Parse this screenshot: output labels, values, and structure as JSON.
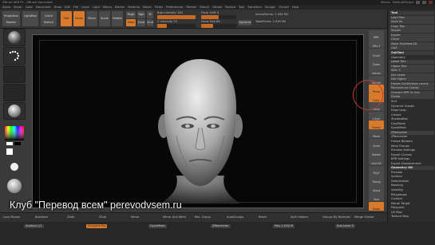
{
  "window": {
    "title": "ZBrush 4R8 P2 - ZBrush Document",
    "controls": [
      "Menus",
      "DefaultZScript"
    ]
  },
  "menu": {
    "items": [
      "Alpha",
      "Brush",
      "Color",
      "Document",
      "Draw",
      "Edit",
      "File",
      "Layer",
      "Light",
      "Macro",
      "Marker",
      "Material",
      "Movie",
      "Picker",
      "Preferences",
      "Render",
      "Stencil",
      "Stroke",
      "Texture",
      "Tool",
      "Transform",
      "Zplugin",
      "Zscript",
      "Help"
    ]
  },
  "toolbar": {
    "projection_master": "Projection Master",
    "lightbox": "LightBox",
    "quick_sketch": "Quick Sketch",
    "edit": "Edit",
    "draw": "Draw",
    "move": "Move",
    "scale": "Scale",
    "rotate": "Rotate",
    "mrgb": "Mrgb",
    "rgb": "Rgb",
    "m": "M",
    "zadd": "Zadd",
    "zsub": "Zsub",
    "zcut": "Zcut",
    "focal_shift_label": "Focal Shift 0",
    "draw_size_label": "Draw Size 64",
    "rgb_intensity_label": "Rgb Intensity 100",
    "z_intensity_label": "Z Intensity 25",
    "dynamic": "Dynamic",
    "active_points": "ActivePoints: 2.034 Mil",
    "total_points": "TotalPoints: 2.034 Mil",
    "z_intensity_level": 0.25,
    "focal_level": 0.5,
    "draw_size_level": 0.35
  },
  "right_shelf": {
    "buttons": [
      "BPR",
      "SPix 3",
      "Scroll",
      "Zoom",
      "Actual",
      "AAHalf",
      "Persp",
      "Floor",
      "Local",
      "L.Sym",
      "Frame",
      "Move",
      "Scale",
      "Rotate",
      "Line Fill",
      "PolyF",
      "Transp",
      "Ghost",
      "Solo",
      "Xpose"
    ]
  },
  "tray": {
    "items": [
      {
        "label": "Tool",
        "type": "header"
      },
      {
        "label": "Load Tool",
        "type": "box"
      },
      {
        "label": "Save As",
        "type": "box"
      },
      {
        "label": "Copy Tool",
        "type": "box"
      },
      {
        "label": "Import",
        "type": "box"
      },
      {
        "label": "Export",
        "type": "box"
      },
      {
        "label": "Clone",
        "type": "box"
      },
      {
        "label": "Make PolyMesh3D",
        "type": "box"
      },
      {
        "label": "GoZ",
        "type": "box"
      },
      {
        "label": "SubTool",
        "type": "header"
      },
      {
        "label": "Geometry",
        "type": "plain"
      },
      {
        "label": "Lower Res",
        "type": "box"
      },
      {
        "label": "Higher Res",
        "type": "box"
      },
      {
        "label": "SDiv 5",
        "type": "box"
      },
      {
        "label": "Del Lower",
        "type": "box"
      },
      {
        "label": "Del Higher",
        "type": "box"
      },
      {
        "label": "Freeze SubDivision Levels",
        "type": "box"
      },
      {
        "label": "Reconstruct Subdiv",
        "type": "box"
      },
      {
        "label": "Convert BPR To Geo",
        "type": "box"
      },
      {
        "label": "Divide",
        "type": "box"
      },
      {
        "label": "Smt",
        "type": "plain"
      },
      {
        "label": "Dynamic Subdiv",
        "type": "plain"
      },
      {
        "label": "Edge Loop",
        "type": "plain"
      },
      {
        "label": "Crease",
        "type": "plain"
      },
      {
        "label": "ShadowBox",
        "type": "plain"
      },
      {
        "label": "ClayPolish",
        "type": "plain"
      },
      {
        "label": "DynaMesh",
        "type": "plain"
      },
      {
        "label": "ZRemesher",
        "type": "box"
      },
      {
        "label": "ZRemesher",
        "type": "plain"
      },
      {
        "label": "Freeze Borders",
        "type": "plain"
      },
      {
        "label": "Keep Groups",
        "type": "plain"
      },
      {
        "label": "Preview Settings",
        "type": "plain"
      },
      {
        "label": "Export Canvas",
        "type": "plain"
      },
      {
        "label": "BPR Settings",
        "type": "plain"
      },
      {
        "label": "Export Displacement",
        "type": "plain"
      },
      {
        "label": "Geometry HD",
        "type": "header"
      },
      {
        "label": "Preview",
        "type": "plain"
      },
      {
        "label": "Surface",
        "type": "plain"
      },
      {
        "label": "Deformation",
        "type": "plain"
      },
      {
        "label": "Masking",
        "type": "plain"
      },
      {
        "label": "Visibility",
        "type": "plain"
      },
      {
        "label": "Polygroups",
        "type": "plain"
      },
      {
        "label": "Contact",
        "type": "plain"
      },
      {
        "label": "Morph Target",
        "type": "plain"
      },
      {
        "label": "Polypaint",
        "type": "plain"
      },
      {
        "label": "UV Map",
        "type": "plain"
      },
      {
        "label": "Texture Map",
        "type": "plain"
      }
    ]
  },
  "bottom_bar": {
    "items": [
      "Lazy Mouse",
      "Backface",
      "ZAdd",
      "ZSub",
      "Mirror",
      "Mirror And Weld",
      "Rec. Group",
      "AutoGroups",
      "Reset",
      "Split Hidden",
      "Groups By Normals",
      "Merge Similar"
    ]
  },
  "status_bar": {
    "items": [
      "Subtool 1/1",
      "Sculptris Pro",
      "DynaMesh",
      "ZRemesher",
      "Poly 2.034 M",
      "Sub Level 5"
    ]
  },
  "watermark": "Клуб \"Перевод всем\" perevodvsem.ru",
  "colors": {
    "accent": "#d9792b",
    "annotation": "#c33a3a"
  }
}
